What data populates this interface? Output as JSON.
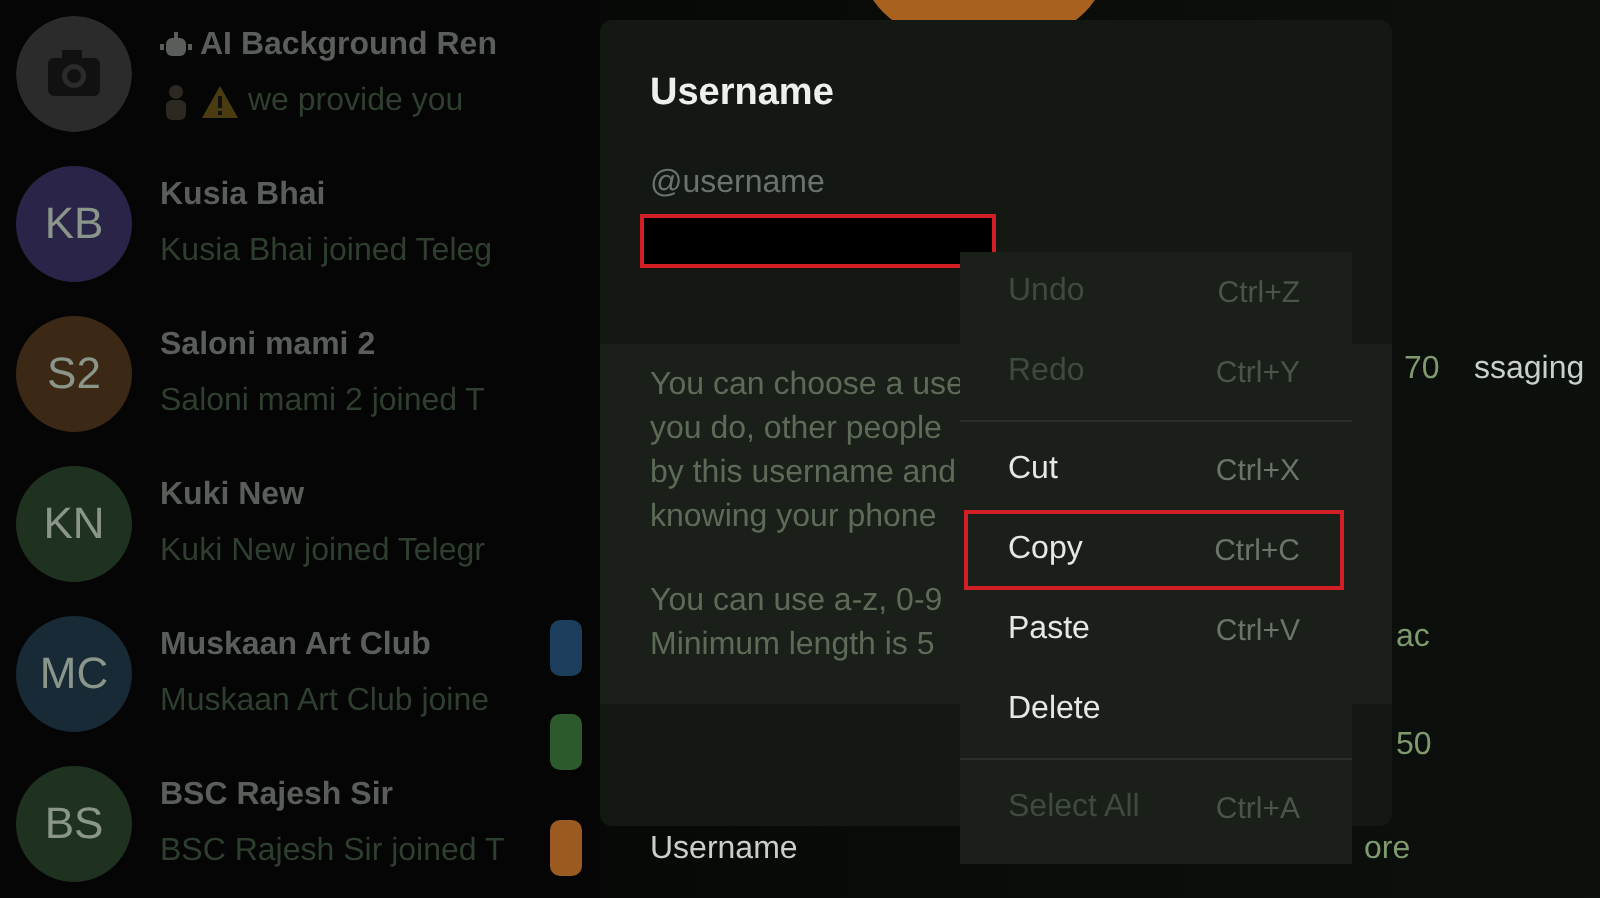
{
  "chats": [
    {
      "kind": "photo",
      "name": "AI Background Ren",
      "preview": "we provide you"
    },
    {
      "kind": "initials",
      "initials": "KB",
      "color": "#2a2548",
      "name": "Kusia Bhai",
      "preview": "Kusia Bhai joined Teleg"
    },
    {
      "kind": "initials",
      "initials": "S2",
      "color": "#3b2916",
      "name": "Saloni mami 2",
      "preview": "Saloni mami 2 joined T"
    },
    {
      "kind": "initials",
      "initials": "KN",
      "color": "#1f3220",
      "name": "Kuki New",
      "preview": "Kuki New joined Telegr"
    },
    {
      "kind": "initials",
      "initials": "MC",
      "color": "#182a36",
      "name": "Muskaan Art Club",
      "preview": "Muskaan Art Club joine"
    },
    {
      "kind": "initials",
      "initials": "BS",
      "color": "#1f321f",
      "name": "BSC Rajesh Sir",
      "preview": "BSC Rajesh Sir joined T"
    }
  ],
  "background": {
    "texts": [
      "70",
      "ssaging",
      "ac",
      "50",
      "Username",
      "ore"
    ]
  },
  "dialog": {
    "title": "Username",
    "field": {
      "placeholder": "@username"
    },
    "redaction": {
      "highlighted": true
    },
    "info": [
      "You can choose a use",
      "you do, other people",
      "by this username and",
      "knowing your phone"
    ],
    "info_rules": [
      "You can use a-z, 0-9",
      "Minimum length is 5"
    ]
  },
  "menu": [
    {
      "kind": "item",
      "label": "Undo",
      "shortcut": "Ctrl+Z",
      "disabled": true,
      "highlighted": false
    },
    {
      "kind": "item",
      "label": "Redo",
      "shortcut": "Ctrl+Y",
      "disabled": true,
      "highlighted": false
    },
    {
      "kind": "separator"
    },
    {
      "kind": "item",
      "label": "Cut",
      "shortcut": "Ctrl+X",
      "disabled": false,
      "highlighted": false
    },
    {
      "kind": "item",
      "label": "Copy",
      "shortcut": "Ctrl+C",
      "disabled": false,
      "highlighted": true
    },
    {
      "kind": "item",
      "label": "Paste",
      "shortcut": "Ctrl+V",
      "disabled": false,
      "highlighted": false
    },
    {
      "kind": "item",
      "label": "Delete",
      "disabled": false,
      "highlighted": false
    },
    {
      "kind": "separator"
    },
    {
      "kind": "item",
      "label": "Select All",
      "shortcut": "Ctrl+A",
      "disabled": true,
      "highlighted": false
    }
  ]
}
